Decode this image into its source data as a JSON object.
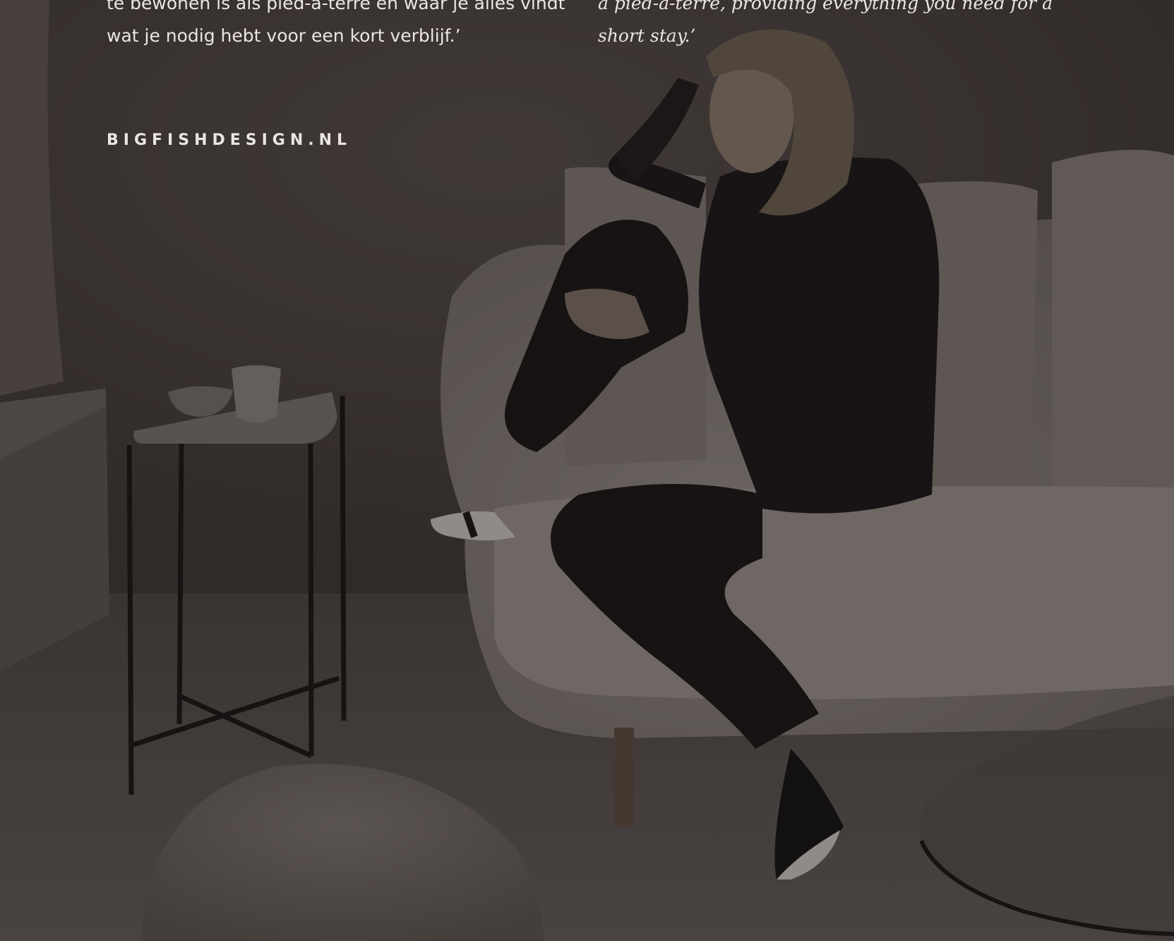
{
  "hero": {
    "quote_nl": "te bewonen is als pied-a-terre en waar je alles vindt wat je nodig hebt voor een kort verblijf.’",
    "quote_en": "a pied-a-terre, providing everything you need for a short stay.’",
    "site_link": "BIGFISHDESIGN.NL"
  },
  "colors": {
    "text": "#ece6e2",
    "wall": "#4a4441",
    "sofa": "#8f8782",
    "outfit": "#161314"
  }
}
